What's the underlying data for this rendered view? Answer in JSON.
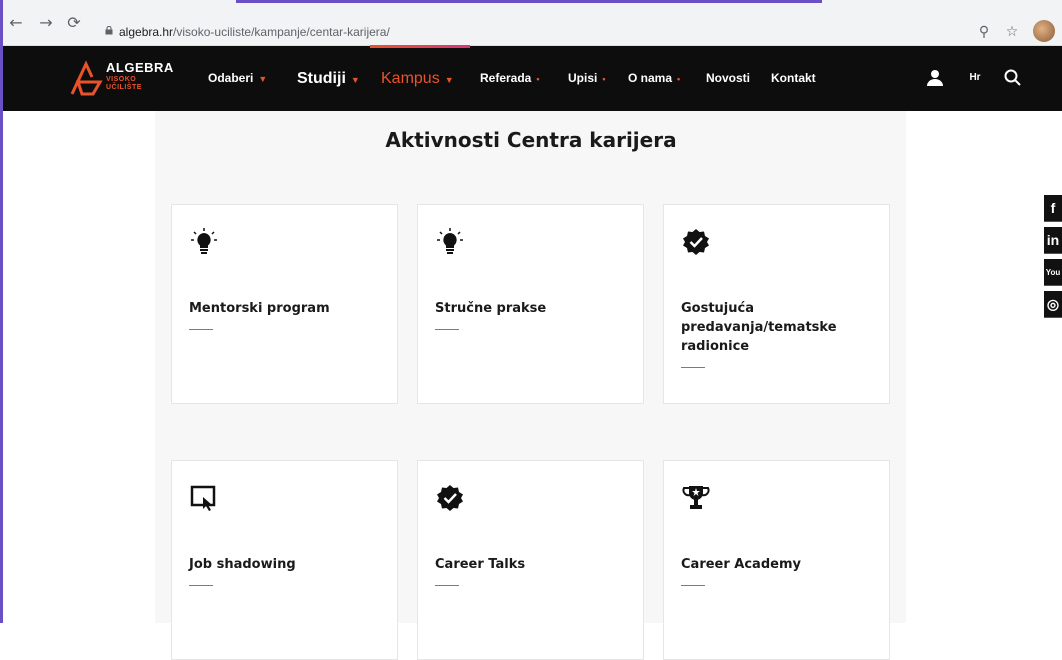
{
  "browser": {
    "url_host": "algebra.hr",
    "url_path": "/visoko-uciliste/kampanje/centar-karijera/"
  },
  "header": {
    "logo": {
      "name": "ALGEBRA",
      "sub1": "VISOKO",
      "sub2": "UČILIŠTE"
    },
    "menu": [
      {
        "label": "Odaberi",
        "caret": "▼"
      },
      {
        "label": "Studiji",
        "caret": "▼"
      },
      {
        "label": "Kampus",
        "caret": "▼"
      },
      {
        "label": "Referada",
        "caret": "•"
      },
      {
        "label": "Upisi",
        "caret": "•"
      },
      {
        "label": "O nama",
        "caret": "•"
      },
      {
        "label": "Novosti"
      },
      {
        "label": "Kontakt"
      }
    ],
    "lang": "Hr"
  },
  "page": {
    "title": "Aktivnosti Centra karijera",
    "cards": [
      {
        "title": "Mentorski program",
        "icon": "lightbulb-icon"
      },
      {
        "title": "Stručne prakse",
        "icon": "lightbulb-icon"
      },
      {
        "title": "Gostujuća predavanja/tematske radionice",
        "icon": "verified-badge-icon"
      },
      {
        "title": "Job shadowing",
        "icon": "touch-screen-icon"
      },
      {
        "title": "Career Talks",
        "icon": "verified-badge-icon"
      },
      {
        "title": "Career Academy",
        "icon": "trophy-icon"
      }
    ]
  },
  "social": {
    "facebook": "f",
    "linkedin": "in",
    "youtube": "You",
    "instagram": "◎"
  },
  "colors": {
    "accent": "#e9532b",
    "header_bg": "#0d0d0d",
    "frame": "#6b4fc4"
  }
}
